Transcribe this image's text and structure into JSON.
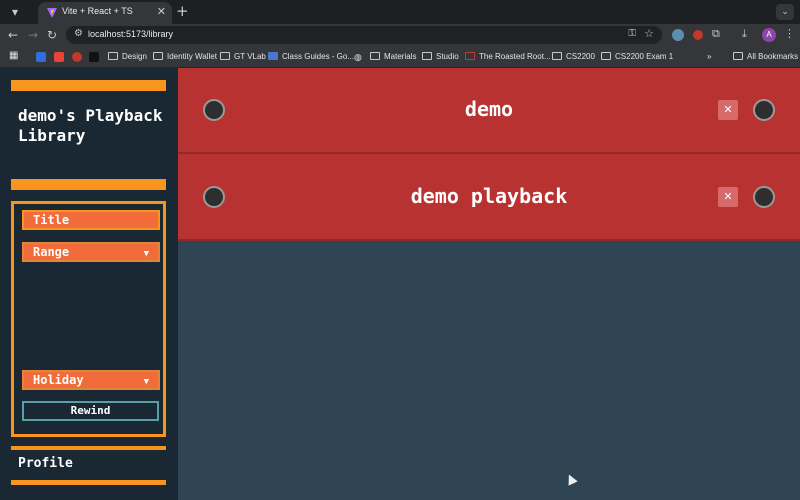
{
  "browser": {
    "tab_title": "Vite + React + TS",
    "url": "localhost:5173/library",
    "avatar_letter": "A",
    "bookmarks": [
      "Design",
      "Identity Wallet",
      "GT VLab",
      "Class Guides - Go...",
      "Materials",
      "Studio",
      "The Roasted Root...",
      "CS2200",
      "CS2200 Exam 1"
    ],
    "all_bookmarks": "All Bookmarks"
  },
  "sidebar": {
    "library_title": "demo's Playback Library",
    "title_input_value": "Title",
    "range_select": "Range",
    "holiday_select": "Holiday",
    "rewind_label": "Rewind",
    "profile_label": "Profile"
  },
  "playbacks": [
    {
      "title": "demo"
    },
    {
      "title": "demo playback"
    }
  ],
  "colors": {
    "accent_orange": "#f7951f",
    "input_orange": "#f26b3a",
    "card_red": "#b83232",
    "sidebar_bg": "#1a2833",
    "main_bg": "#2f4553"
  },
  "icons": {
    "delete": "close-x-icon",
    "knob": "screw-knob-icon"
  }
}
